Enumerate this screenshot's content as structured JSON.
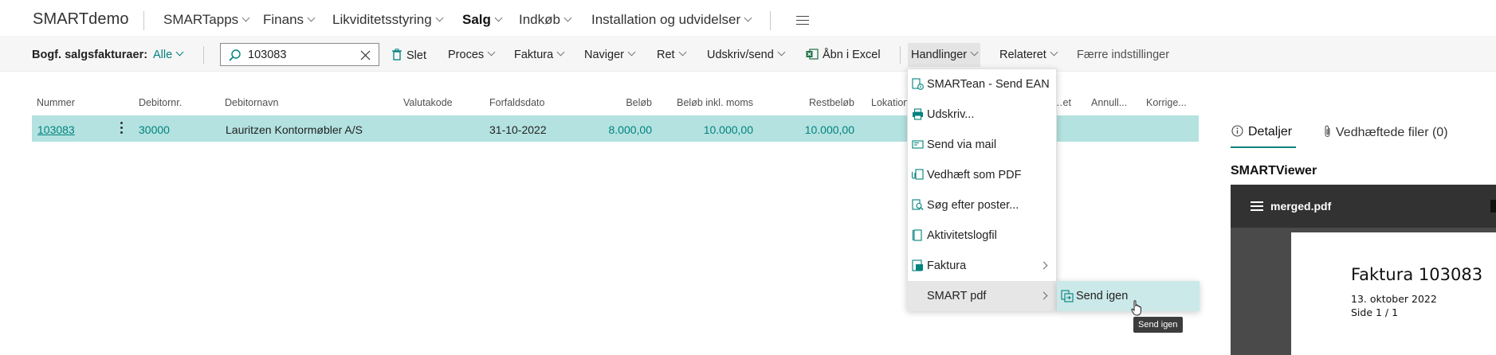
{
  "topnav": {
    "app_title": "SMARTdemo",
    "items": [
      {
        "label": "SMARTapps",
        "has_menu": true
      },
      {
        "label": "Finans",
        "has_menu": true
      },
      {
        "label": "Likviditetsstyring",
        "has_menu": true
      },
      {
        "label": "Salg",
        "has_menu": true,
        "active": true
      },
      {
        "label": "Indkøb",
        "has_menu": true
      },
      {
        "label": "Installation og udvidelser",
        "has_menu": true
      }
    ]
  },
  "actionbar": {
    "list_label": "Bogf. salgsfakturaer:",
    "filter_label": "Alle",
    "search": {
      "value": "103083"
    },
    "actions": [
      {
        "label": "Slet",
        "icon": "trash-icon"
      },
      {
        "label": "Proces",
        "has_menu": true
      },
      {
        "label": "Faktura",
        "has_menu": true
      },
      {
        "label": "Naviger",
        "has_menu": true
      },
      {
        "label": "Ret",
        "has_menu": true
      },
      {
        "label": "Udskriv/send",
        "has_menu": true
      },
      {
        "label": "Åbn i Excel",
        "icon": "excel-icon"
      },
      {
        "label": "Handlinger",
        "has_menu": true,
        "open": true
      },
      {
        "label": "Relateret",
        "has_menu": true
      },
      {
        "label": "Færre indstillinger"
      }
    ]
  },
  "table": {
    "columns": [
      "Nummer",
      "Debitornr.",
      "Debitornavn",
      "Valutakode",
      "Forfaldsdato",
      "Beløb",
      "Beløb inkl. moms",
      "Restbeløb",
      "Lokation",
      "…et",
      "Annull...",
      "Korrige..."
    ],
    "rows": [
      {
        "nummer": "103083",
        "debitornr": "30000",
        "debitornavn": "Lauritzen Kontormøbler A/S",
        "valutakode": "",
        "forfaldsdato": "31-10-2022",
        "beloeb": "8.000,00",
        "beloeb_inkl_moms": "10.000,00",
        "restbeloeb": "10.000,00"
      }
    ]
  },
  "dropdown": {
    "items": [
      {
        "label": "SMARTean - Send EAN",
        "icon": "ean-send-icon"
      },
      {
        "label": "Udskriv...",
        "icon": "printer-icon"
      },
      {
        "label": "Send via mail",
        "icon": "mail-icon"
      },
      {
        "label": "Vedhæft som PDF",
        "icon": "attach-pdf-icon"
      },
      {
        "label": "Søg efter poster...",
        "icon": "search-entries-icon"
      },
      {
        "label": "Aktivitetslogfil",
        "icon": "log-icon"
      },
      {
        "label": "Faktura",
        "icon": "invoice-icon",
        "submenu": true
      },
      {
        "label": "SMART pdf",
        "submenu": true,
        "highlighted": true
      }
    ],
    "submenu": {
      "label": "Send igen",
      "icon": "resend-icon",
      "tooltip": "Send igen"
    }
  },
  "details_pane": {
    "tabs": [
      {
        "label": "Detaljer",
        "icon": "info-icon",
        "active": true
      },
      {
        "label": "Vedhæftede filer (0)",
        "icon": "paperclip-icon"
      }
    ],
    "title": "SMARTViewer",
    "viewer": {
      "file_name": "merged.pdf",
      "doc_title": "Faktura 103083",
      "doc_date": "13. oktober 2022",
      "doc_page": "Side  1 / 1"
    }
  },
  "colors": {
    "accent": "#00827e",
    "row_selected": "#b3e2e0",
    "submenu_hover": "#cbe9e8"
  }
}
